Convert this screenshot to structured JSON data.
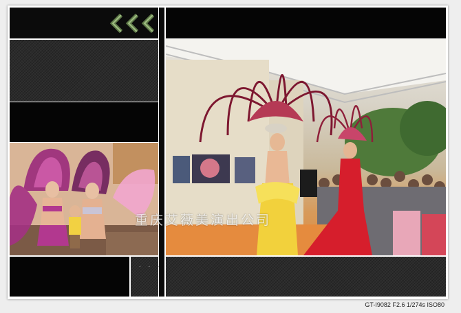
{
  "gallery": {
    "watermark_text": "重庆艾薇美演出公司",
    "nav_icon": "triple-chevron-left-icon",
    "dots_text": ". . ."
  },
  "status": {
    "exif": "GT-I9082 F2.6 1/274s ISO80"
  },
  "colors": {
    "panel_dark": "#111111",
    "panel_texture": "#2b2b2b",
    "chevron_green": "#7d9a63",
    "frame_bg": "#ffffff",
    "page_bg": "#eeeeee"
  }
}
